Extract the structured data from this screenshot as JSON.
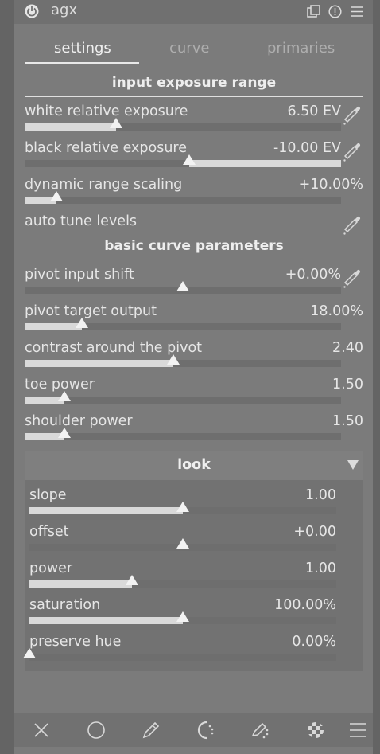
{
  "module": {
    "title": "agx",
    "icons": [
      "power-icon",
      "multi-instance-icon",
      "reset-icon",
      "presets-icon"
    ]
  },
  "tabs": [
    {
      "label": "settings",
      "active": true
    },
    {
      "label": "curve",
      "active": false
    },
    {
      "label": "primaries",
      "active": false
    }
  ],
  "sections": {
    "input_exposure_range": "input exposure range",
    "basic_curve_parameters": "basic curve parameters"
  },
  "sliders": {
    "white_relative_exposure": {
      "label": "white relative exposure",
      "value": "6.50 EV",
      "fraction": 0.29,
      "picker": true
    },
    "black_relative_exposure": {
      "label": "black relative exposure",
      "value": "-10.00 EV",
      "fraction": 0.52,
      "picker": true
    },
    "dynamic_range_scaling": {
      "label": "dynamic range scaling",
      "value": "+10.00%",
      "fraction": 0.1,
      "picker": false
    },
    "auto_tune_levels": {
      "label": "auto tune levels",
      "picker": true
    },
    "pivot_input_shift": {
      "label": "pivot input shift",
      "value": "+0.00%",
      "fraction": 0.5,
      "picker": true
    },
    "pivot_target_output": {
      "label": "pivot target output",
      "value": "18.00%",
      "fraction": 0.18
    },
    "contrast_around_pivot": {
      "label": "contrast around the pivot",
      "value": "2.40",
      "fraction": 0.47
    },
    "toe_power": {
      "label": "toe power",
      "value": "1.50",
      "fraction": 0.125
    },
    "shoulder_power": {
      "label": "shoulder power",
      "value": "1.50",
      "fraction": 0.125
    }
  },
  "look": {
    "title": "look",
    "slope": {
      "label": "slope",
      "value": "1.00",
      "fraction": 0.5
    },
    "offset": {
      "label": "offset",
      "value": "+0.00",
      "fraction": 0.5
    },
    "power": {
      "label": "power",
      "value": "1.00",
      "fraction": 0.333
    },
    "saturation": {
      "label": "saturation",
      "value": "100.00%",
      "fraction": 0.5
    },
    "preserve_hue": {
      "label": "preserve hue",
      "value": "0.00%",
      "fraction": 0.0
    }
  },
  "bottom_toolbar": [
    "close-icon",
    "circle-icon",
    "pencil-icon",
    "dotted-arc-icon",
    "drawn-mask-icon",
    "checkerboard-icon",
    "menu-icon"
  ]
}
